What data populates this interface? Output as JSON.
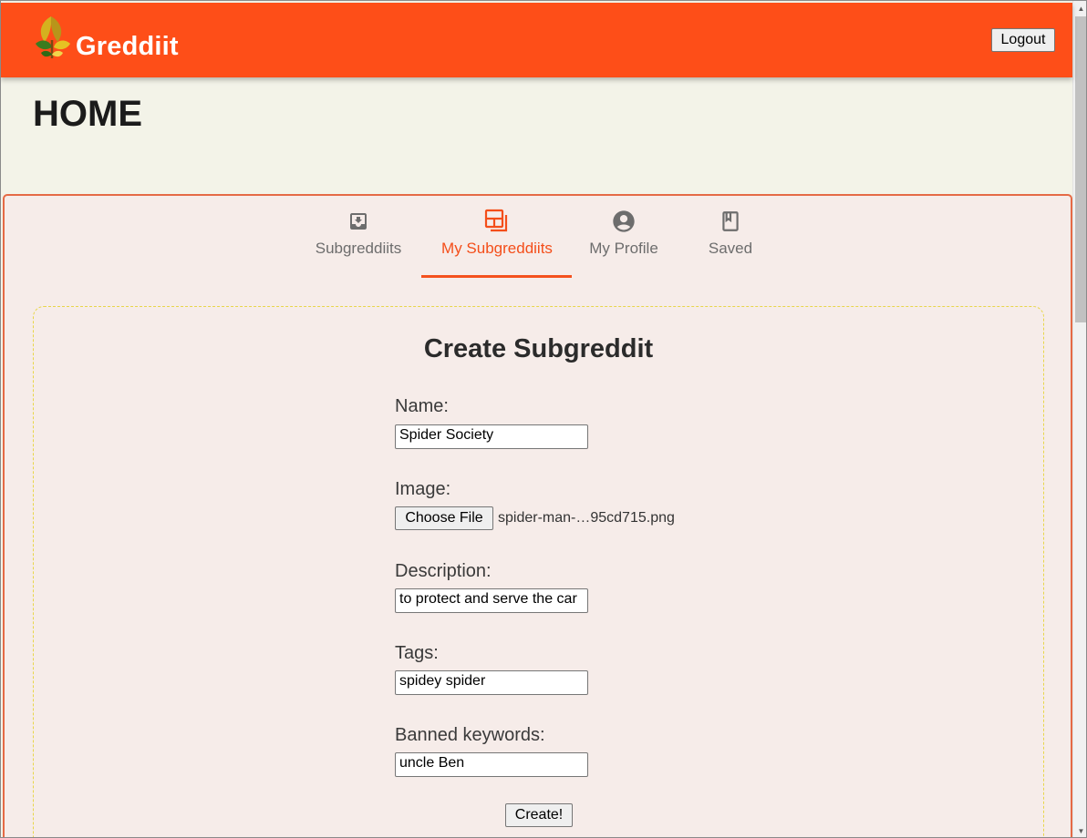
{
  "header": {
    "brand": "Greddiit",
    "logout_label": "Logout",
    "accent_color": "#fe4e18",
    "logo_icon": "leaf-logo-icon"
  },
  "page": {
    "title": "HOME"
  },
  "tabs": [
    {
      "label": "Subgreddiits",
      "icon": "inbox-icon",
      "active": false
    },
    {
      "label": "My Subgreddiits",
      "icon": "layers-icon",
      "active": true
    },
    {
      "label": "My Profile",
      "icon": "account-circle-icon",
      "active": false
    },
    {
      "label": "Saved",
      "icon": "bookmark-icon",
      "active": false
    }
  ],
  "form": {
    "title": "Create Subgreddit",
    "name_label": "Name:",
    "name_value": "Spider Society",
    "image_label": "Image:",
    "choose_file_label": "Choose File",
    "file_name": "spider-man-…95cd715.png",
    "description_label": "Description:",
    "description_value": "to protect and serve the car",
    "tags_label": "Tags:",
    "tags_value": "spidey spider",
    "banned_label": "Banned keywords:",
    "banned_value": "uncle Ben",
    "create_label": "Create!"
  }
}
